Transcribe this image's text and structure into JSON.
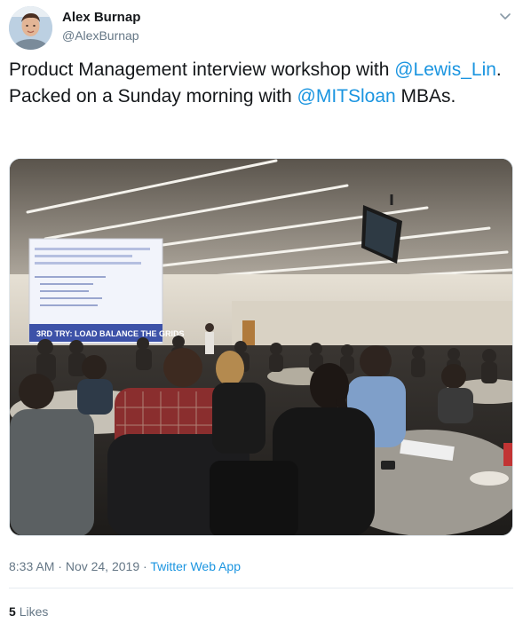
{
  "author": {
    "name": "Alex Burnap",
    "handle": "@AlexBurnap"
  },
  "tweet": {
    "text_part1": "Product Management interview workshop with ",
    "mention1": "@Lewis_Lin",
    "text_part2": ". Packed on a Sunday morning with ",
    "mention2": "@MITSloan",
    "text_part3": " MBAs."
  },
  "photo": {
    "slide_banner": "3RD TRY: LOAD BALANCE THE GRIDS"
  },
  "footer": {
    "time": "8:33 AM",
    "separator1": " · ",
    "date": "Nov 24, 2019",
    "separator2": " · ",
    "source": "Twitter Web App"
  },
  "stats": {
    "likes_count": "5",
    "likes_label": "Likes"
  },
  "colors": {
    "link": "#1b95e0",
    "secondary": "#657786",
    "text": "#14171a"
  },
  "icons": {
    "caret": "chevron-down-icon",
    "avatar": "avatar"
  }
}
